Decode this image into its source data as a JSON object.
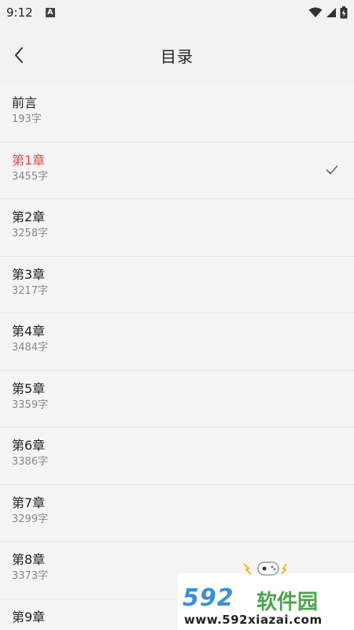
{
  "status_bar": {
    "time": "9:12",
    "notification_letter": "A"
  },
  "header": {
    "title": "目录"
  },
  "chapters": [
    {
      "title": "前言",
      "count": "193字",
      "active": false
    },
    {
      "title": "第1章",
      "count": "3455字",
      "active": true
    },
    {
      "title": "第2章",
      "count": "3258字",
      "active": false
    },
    {
      "title": "第3章",
      "count": "3217字",
      "active": false
    },
    {
      "title": "第4章",
      "count": "3484字",
      "active": false
    },
    {
      "title": "第5章",
      "count": "3359字",
      "active": false
    },
    {
      "title": "第6章",
      "count": "3386字",
      "active": false
    },
    {
      "title": "第7章",
      "count": "3299字",
      "active": false
    },
    {
      "title": "第8章",
      "count": "3373字",
      "active": false
    },
    {
      "title": "第9章",
      "count": "",
      "active": false
    }
  ],
  "watermark": {
    "brand": "592",
    "brand_cn": "软件园",
    "url": "www.592xiazai.com"
  },
  "colors": {
    "active": "#e0484a",
    "background": "#f5f5f5",
    "divider": "#e6e6e6"
  }
}
